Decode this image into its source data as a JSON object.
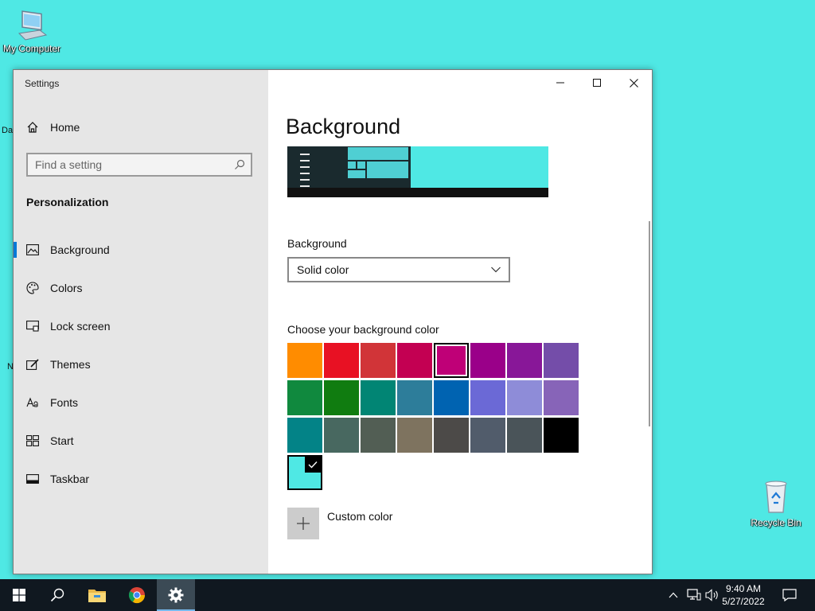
{
  "desktop": {
    "my_computer": "My Computer",
    "recycle_bin": "Recycle Bin",
    "edge_fragment_1": "Da",
    "edge_fragment_2": "N"
  },
  "window": {
    "title": "Settings",
    "controls": [
      "minimize",
      "maximize",
      "close"
    ]
  },
  "sidebar": {
    "home": "Home",
    "search_placeholder": "Find a setting",
    "section_title": "Personalization",
    "items": [
      {
        "label": "Background",
        "icon": "picture-icon",
        "active": true
      },
      {
        "label": "Colors",
        "icon": "palette-icon",
        "active": false
      },
      {
        "label": "Lock screen",
        "icon": "lock-screen-icon",
        "active": false
      },
      {
        "label": "Themes",
        "icon": "themes-icon",
        "active": false
      },
      {
        "label": "Fonts",
        "icon": "fonts-icon",
        "active": false
      },
      {
        "label": "Start",
        "icon": "start-icon",
        "active": false
      },
      {
        "label": "Taskbar",
        "icon": "taskbar-icon",
        "active": false
      }
    ]
  },
  "content": {
    "title": "Background",
    "background_label": "Background",
    "background_value": "Solid color",
    "choose_color_label": "Choose your background color",
    "colors": [
      [
        "#ff8c00",
        "#e81123",
        "#d13438",
        "#c30052",
        "#bf0077",
        "#9a0089",
        "#881798",
        "#744da9"
      ],
      [
        "#10893e",
        "#107c10",
        "#018574",
        "#2d7d9a",
        "#0063b1",
        "#6b69d6",
        "#8e8cd8",
        "#8764b8"
      ],
      [
        "#038387",
        "#486860",
        "#525e54",
        "#7e735f",
        "#4c4a48",
        "#515c6b",
        "#4a5459",
        "#000000"
      ]
    ],
    "selected_color": "#4fe8e4",
    "custom_color_label": "Custom color"
  },
  "taskbar": {
    "time": "9:40 AM",
    "date": "5/27/2022",
    "apps": [
      "start-icon",
      "search-icon",
      "file-explorer-icon",
      "chrome-icon",
      "settings-icon"
    ]
  }
}
